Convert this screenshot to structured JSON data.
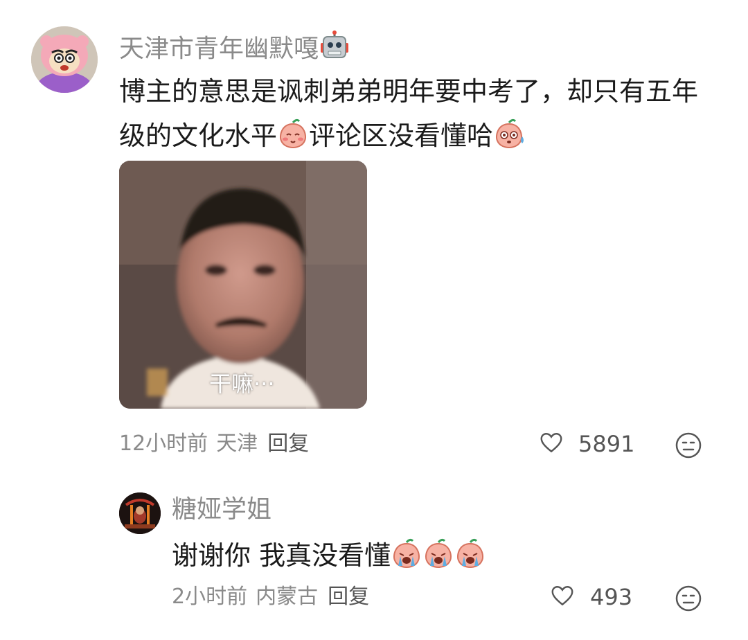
{
  "comment": {
    "username": "天津市青年幽默嘎",
    "username_emoji": "robot-emoji",
    "text_part1": "博主的意思是讽刺弟弟明年要中考了，却只有五年级的文化水平",
    "text_part2": "评论区没看懂哈",
    "emoji_after_part1": "blush-peach-emoji",
    "emoji_after_part2": "dazed-peach-emoji",
    "image_caption": "干嘛···",
    "time": "12小时前",
    "location": "天津",
    "reply_label": "回复",
    "like_count": "5891"
  },
  "reply": {
    "username": "糖娅学姐",
    "text": "谢谢你 我真没看懂",
    "emojis": [
      "crying-peach-emoji",
      "crying-peach-emoji",
      "crying-peach-emoji"
    ],
    "time": "2小时前",
    "location": "内蒙古",
    "reply_label": "回复",
    "like_count": "493"
  },
  "colors": {
    "username": "#8a8a8a",
    "text": "#1b1b1b",
    "meta": "#8a8a8a"
  }
}
